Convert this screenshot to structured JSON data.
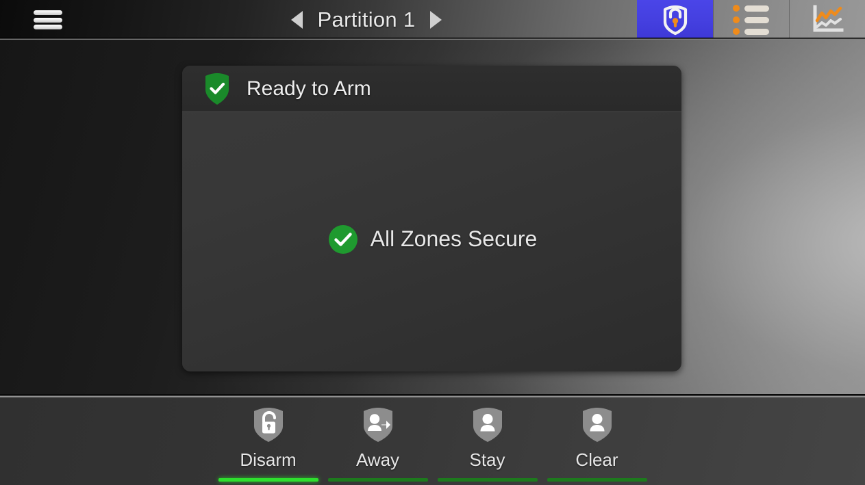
{
  "topbar": {
    "menu_icon": "hamburger-menu-icon",
    "prev_arrow": "chevron-left-icon",
    "next_arrow": "chevron-right-icon",
    "title": "Partition 1",
    "tiles": [
      {
        "name": "security-tab",
        "icon": "shield-lock-icon",
        "active": true,
        "accent": "#4a45e8"
      },
      {
        "name": "list-tab",
        "icon": "bullet-list-icon",
        "active": false,
        "accent": "#ef8b1b"
      },
      {
        "name": "analytics-tab",
        "icon": "line-chart-icon",
        "active": false,
        "accent": "#ef8b1b"
      }
    ]
  },
  "panel": {
    "status_icon": "shield-check-icon",
    "status_color": "#1a8a2a",
    "status_title": "Ready to Arm",
    "zone_icon": "circle-check-icon",
    "zone_color": "#1f9a2f",
    "zone_message": "All Zones Secure"
  },
  "actions": [
    {
      "label": "Disarm",
      "icon": "shield-unlocked-icon",
      "underline": "#2ee02e",
      "selected": true
    },
    {
      "label": "Away",
      "icon": "shield-person-away-icon",
      "underline": "#1d7a1d",
      "selected": false
    },
    {
      "label": "Stay",
      "icon": "shield-person-icon",
      "underline": "#1d7a1d",
      "selected": false
    },
    {
      "label": "Clear",
      "icon": "shield-person-icon",
      "underline": "#1d7a1d",
      "selected": false
    }
  ]
}
